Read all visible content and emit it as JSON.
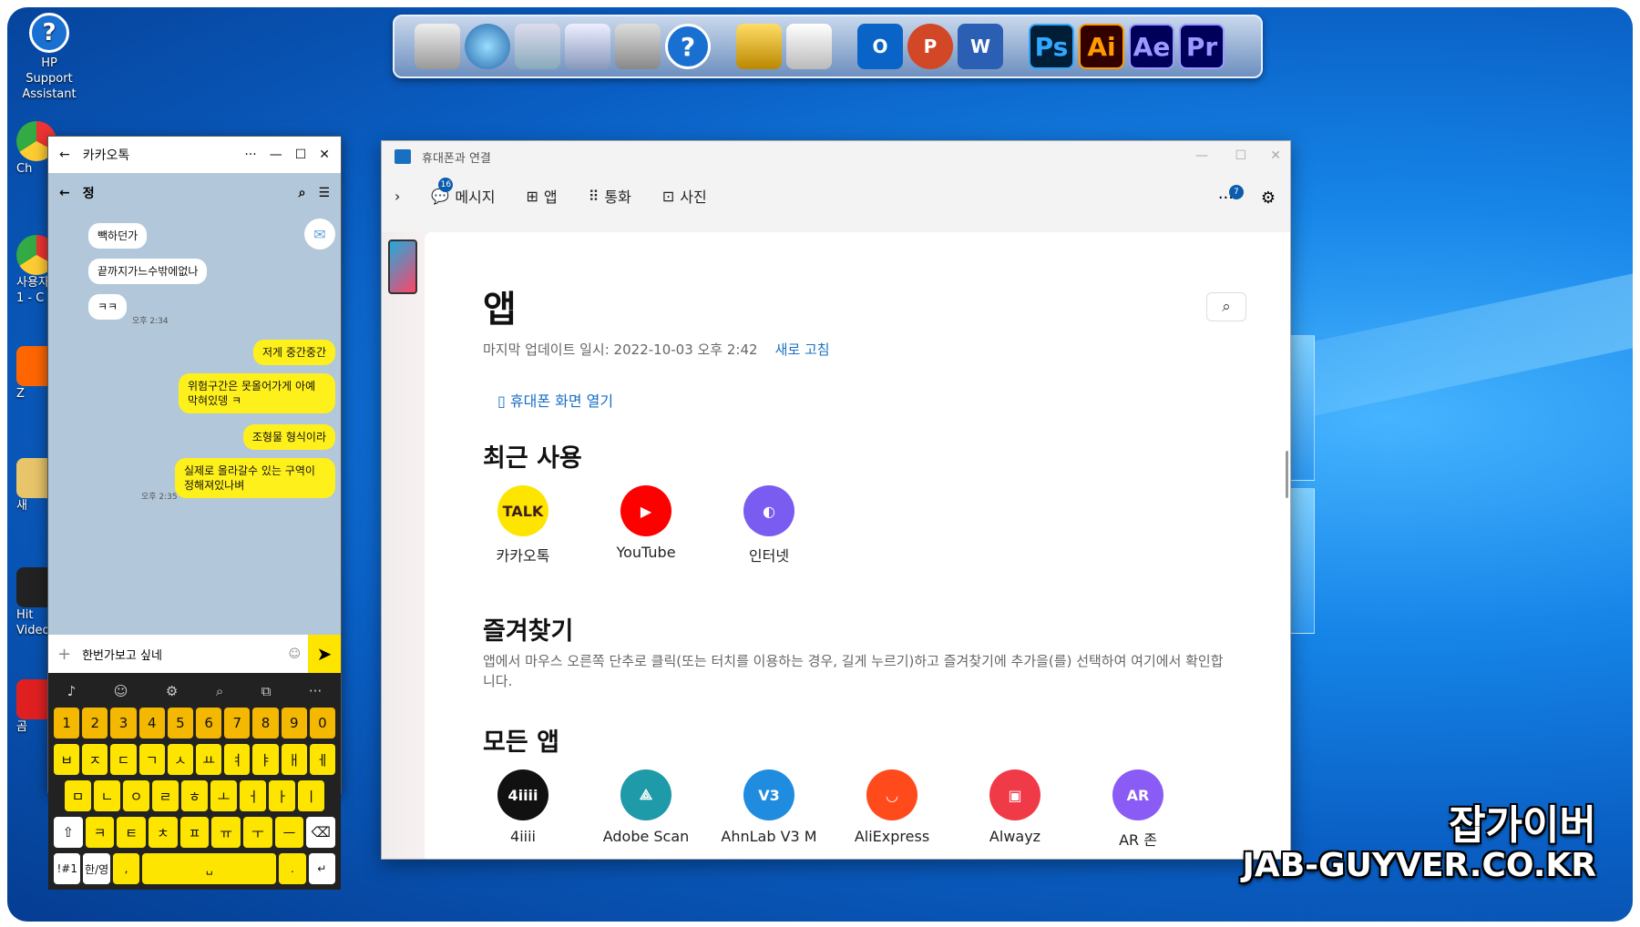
{
  "desktop": {
    "icons": [
      {
        "label": "HP Support Assistant"
      },
      {
        "label": "Ch"
      },
      {
        "label": "사용자 1 - C"
      },
      {
        "label": "Z"
      },
      {
        "label": "새"
      },
      {
        "label": "Hit Video"
      },
      {
        "label": "곰"
      }
    ]
  },
  "dock": {
    "apps": [
      {
        "icon": "computer-icon"
      },
      {
        "icon": "globe-icon"
      },
      {
        "icon": "folder-icon"
      },
      {
        "icon": "folder-open-icon"
      },
      {
        "icon": "tools-icon"
      },
      {
        "icon": "help-icon",
        "glyph": "?"
      },
      {
        "icon": "hammer-icon"
      },
      {
        "icon": "recycle-bin-icon"
      },
      {
        "icon": "outlook-icon",
        "glyph": "O"
      },
      {
        "icon": "powerpoint-icon",
        "glyph": "P"
      },
      {
        "icon": "word-icon",
        "glyph": "W"
      },
      {
        "icon": "photoshop-icon",
        "glyph": "Ps"
      },
      {
        "icon": "illustrator-icon",
        "glyph": "Ai"
      },
      {
        "icon": "after-effects-icon",
        "glyph": "Ae"
      },
      {
        "icon": "premiere-icon",
        "glyph": "Pr"
      }
    ]
  },
  "kakao": {
    "title": "카카오톡",
    "chat_name": "정",
    "messages": [
      {
        "side": "left",
        "text": "빽하던가"
      },
      {
        "side": "left",
        "text": "끝까지가느수밖에없나"
      },
      {
        "side": "left",
        "text": "ㅋㅋ",
        "time": "오후 2:34"
      },
      {
        "side": "right",
        "text": "저게 중간중간"
      },
      {
        "side": "right",
        "text": "위험구간은 못올어가게 아예 막혀있뎅 ㅋ"
      },
      {
        "side": "right",
        "text": "조형물 형식이라"
      },
      {
        "side": "right",
        "text": "실제로 올라갈수 있는 구역이 정해져있나벼",
        "time": "오후 2:35"
      }
    ],
    "input": "한번가보고 싶네",
    "keyboard": {
      "row1": [
        "1",
        "2",
        "3",
        "4",
        "5",
        "6",
        "7",
        "8",
        "9",
        "0"
      ],
      "row2": [
        "ㅂ",
        "ㅈ",
        "ㄷ",
        "ㄱ",
        "ㅅ",
        "ㅛ",
        "ㅕ",
        "ㅑ",
        "ㅐ",
        "ㅔ"
      ],
      "row3": [
        "ㅁ",
        "ㄴ",
        "ㅇ",
        "ㄹ",
        "ㅎ",
        "ㅗ",
        "ㅓ",
        "ㅏ",
        "ㅣ"
      ],
      "row4": [
        "⇧",
        "ㅋ",
        "ㅌ",
        "ㅊ",
        "ㅍ",
        "ㅠ",
        "ㅜ",
        "ㅡ",
        "⌫"
      ],
      "row5": [
        "!#1",
        "한/영",
        ",",
        "␣",
        ".",
        "↵"
      ]
    }
  },
  "phonelink": {
    "window_title": "휴대폰과 연결",
    "nav": [
      {
        "label": "메시지",
        "badge": "16"
      },
      {
        "label": "앱"
      },
      {
        "label": "통화"
      },
      {
        "label": "사진"
      }
    ],
    "more_badge": "7",
    "heading": "앱",
    "updated": "마지막 업데이트 일시: 2022-10-03 오후 2:42",
    "refresh": "새로 고침",
    "open_screen": "휴대폰 화면 열기",
    "recent_title": "최근 사용",
    "recent": [
      {
        "label": "카카오톡",
        "glyph": "TALK",
        "color": "#fee500"
      },
      {
        "label": "YouTube",
        "glyph": "▶",
        "color": "#ff0000"
      },
      {
        "label": "인터넷",
        "glyph": "◐",
        "color": "#7b5cf0"
      }
    ],
    "fav_title": "즐겨찾기",
    "fav_text": "앱에서 마우스 오른쪽 단추로 클릭(또는 터치를 이용하는 경우, 길게 누르기)하고 즐겨찾기에 추가을(를) 선택하여 여기에서 확인합니다.",
    "all_title": "모든 앱",
    "all": [
      {
        "label": "4iiii",
        "glyph": "4iiii",
        "color": "#111"
      },
      {
        "label": "Adobe Scan",
        "glyph": "⟁",
        "color": "#1e9aa8"
      },
      {
        "label": "AhnLab V3 M",
        "glyph": "V3",
        "color": "#1f8ce0"
      },
      {
        "label": "AliExpress",
        "glyph": "◡",
        "color": "#ff4a1c"
      },
      {
        "label": "Alwayz",
        "glyph": "▣",
        "color": "#f03a47"
      },
      {
        "label": "AR 존",
        "glyph": "AR",
        "color": "#8a5cf5"
      }
    ]
  },
  "watermark": {
    "line1": "잡가이버",
    "line2": "JAB-GUYVER.CO.KR"
  }
}
